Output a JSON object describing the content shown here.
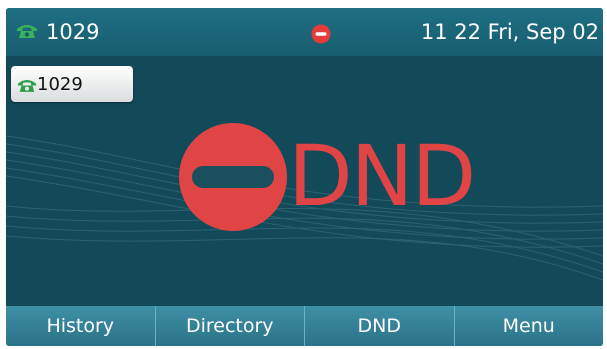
{
  "status_bar": {
    "account": "1029",
    "phone_icon": "green-phone-icon",
    "dnd_icon": "dnd-status-icon",
    "clock": "11 22 Fri, Sep 02"
  },
  "line_key": {
    "icon": "green-phone-icon",
    "label": "1029"
  },
  "main": {
    "dnd_icon": "dnd-icon",
    "dnd_label": "DND"
  },
  "softkeys": [
    {
      "label": "History"
    },
    {
      "label": "Directory"
    },
    {
      "label": "DND"
    },
    {
      "label": "Menu"
    }
  ],
  "colors": {
    "background": "#134a5a",
    "status_bar": "#1f6f82",
    "softkey_bar": "#3f8fa5",
    "dnd_red": "#e04444",
    "phone_green": "#2e9e4b"
  }
}
